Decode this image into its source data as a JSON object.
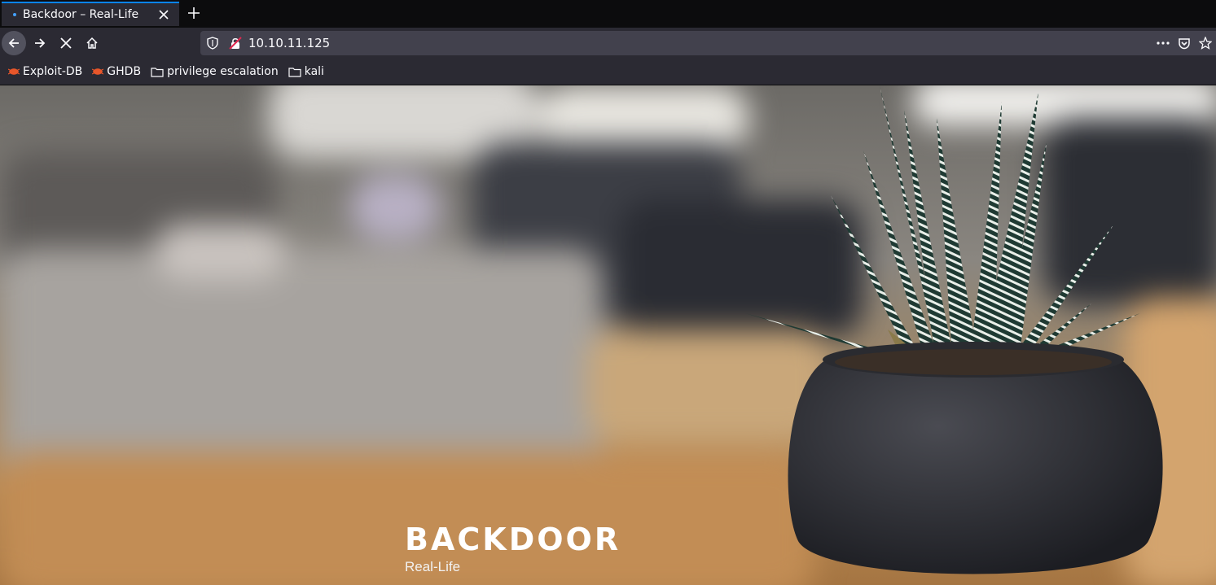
{
  "tab": {
    "title": "Backdoor – Real-Life"
  },
  "navigation": {
    "url": "10.10.11.125"
  },
  "bookmarks": [
    {
      "label": "Exploit-DB",
      "icon": "exploit-db-icon"
    },
    {
      "label": "GHDB",
      "icon": "ghdb-icon"
    },
    {
      "label": "privilege escalation",
      "icon": "folder-icon"
    },
    {
      "label": "kali",
      "icon": "folder-icon"
    }
  ],
  "hero": {
    "site_title": "BACKDOOR",
    "tagline": "Real-Life"
  },
  "colors": {
    "tab_accent": "#0a84ff",
    "toolbar_bg": "#2b2a33",
    "urlbar_bg": "#42414d",
    "title_text": "#ffffff"
  }
}
